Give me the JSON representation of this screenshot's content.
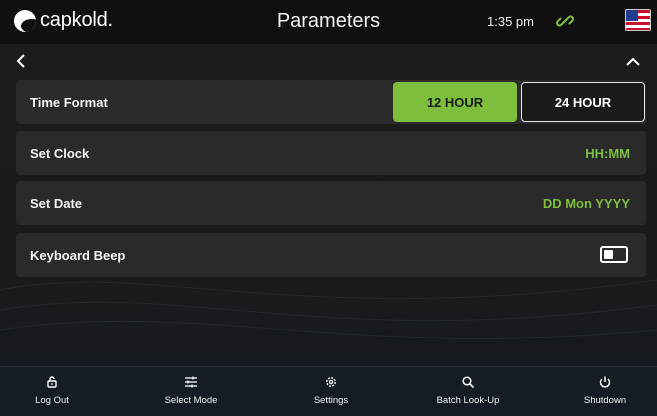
{
  "header": {
    "logo_text": "capkold.",
    "title": "Parameters",
    "time": "1:35 pm",
    "link_status_color": "#7fbe3f"
  },
  "settings": {
    "time_format": {
      "label": "Time Format",
      "options": [
        "12 HOUR",
        "24 HOUR"
      ],
      "selected": "12 HOUR"
    },
    "set_clock": {
      "label": "Set Clock",
      "value": "HH:MM"
    },
    "set_date": {
      "label": "Set Date",
      "value": "DD Mon YYYY"
    },
    "keyboard_beep": {
      "label": "Keyboard Beep",
      "enabled": false
    }
  },
  "footer": {
    "items": [
      {
        "label": "Log Out",
        "icon": "log-out-icon"
      },
      {
        "label": "Select Mode",
        "icon": "sliders-icon"
      },
      {
        "label": "Settings",
        "icon": "gear-icon"
      },
      {
        "label": "Batch Look-Up",
        "icon": "search-icon"
      },
      {
        "label": "Shutdown",
        "icon": "power-icon"
      }
    ]
  },
  "colors": {
    "accent": "#7dbe3c",
    "row_bg": "#2a2a2a",
    "header_bg": "#101010",
    "footer_bg": "#161c24"
  }
}
